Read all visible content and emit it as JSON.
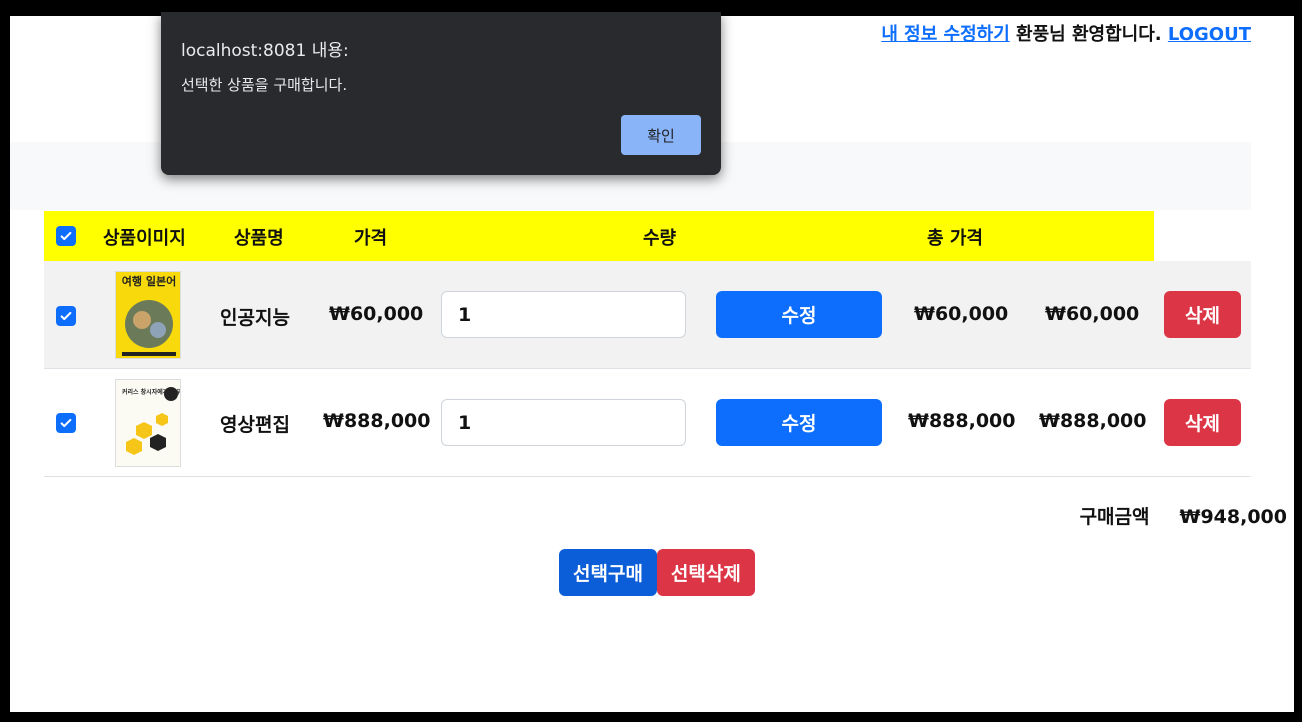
{
  "header": {
    "edit_profile_link": "내 정보 수정하기",
    "welcome_text": " 환풍님 환영합니다. ",
    "logout_link": "LOGOUT"
  },
  "dialog": {
    "origin": "localhost:8081 내용:",
    "message": "선택한 상품을 구매합니다.",
    "ok_label": "확인"
  },
  "table": {
    "headers": [
      "상품이미지",
      "상품명",
      "가격",
      "수량",
      "총 가격"
    ],
    "rows": [
      {
        "checked": true,
        "name": "인공지능",
        "price": "₩60,000",
        "qty": "1",
        "edit_label": "수정",
        "unit_price": "₩60,000",
        "total_price": "₩60,000",
        "delete_label": "삭제",
        "thumb_title": "여행 일본어"
      },
      {
        "checked": true,
        "name": "영상편집",
        "price": "₩888,000",
        "qty": "1",
        "edit_label": "수정",
        "unit_price": "₩888,000",
        "total_price": "₩888,000",
        "delete_label": "삭제",
        "thumb_title": "커리스 창시자에게 배우는 티끌님"
      }
    ]
  },
  "summary": {
    "label": "구매금액",
    "amount": "₩948,000"
  },
  "actions": {
    "buy_selected": "선택구매",
    "delete_selected": "선택삭제"
  },
  "colors": {
    "header_bg": "#ffff00",
    "primary": "#0d6efd",
    "danger": "#dc3545",
    "dialog_bg": "#292a2d",
    "dialog_button": "#8ab4f8"
  }
}
